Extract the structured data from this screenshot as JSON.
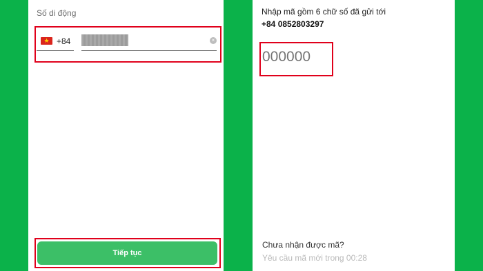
{
  "left_screen": {
    "phone_label": "Số di động",
    "country": {
      "flag": "vietnam-flag-icon",
      "flag_star": "★",
      "code": "+84"
    },
    "phone_input": {
      "value": ""
    },
    "clear_icon": "×",
    "continue_label": "Tiếp tục"
  },
  "right_screen": {
    "otp_prompt": "Nhập mã gồm 6 chữ số đã gửi tới",
    "phone_number": "+84 0852803297",
    "otp_placeholder": "000000",
    "not_received": "Chưa nhận được mã?",
    "resend_text": "Yêu cầu mã mới trong 00:28"
  },
  "colors": {
    "background": "#0bb24a",
    "button": "#3cbf67",
    "highlight": "#e0001b"
  }
}
